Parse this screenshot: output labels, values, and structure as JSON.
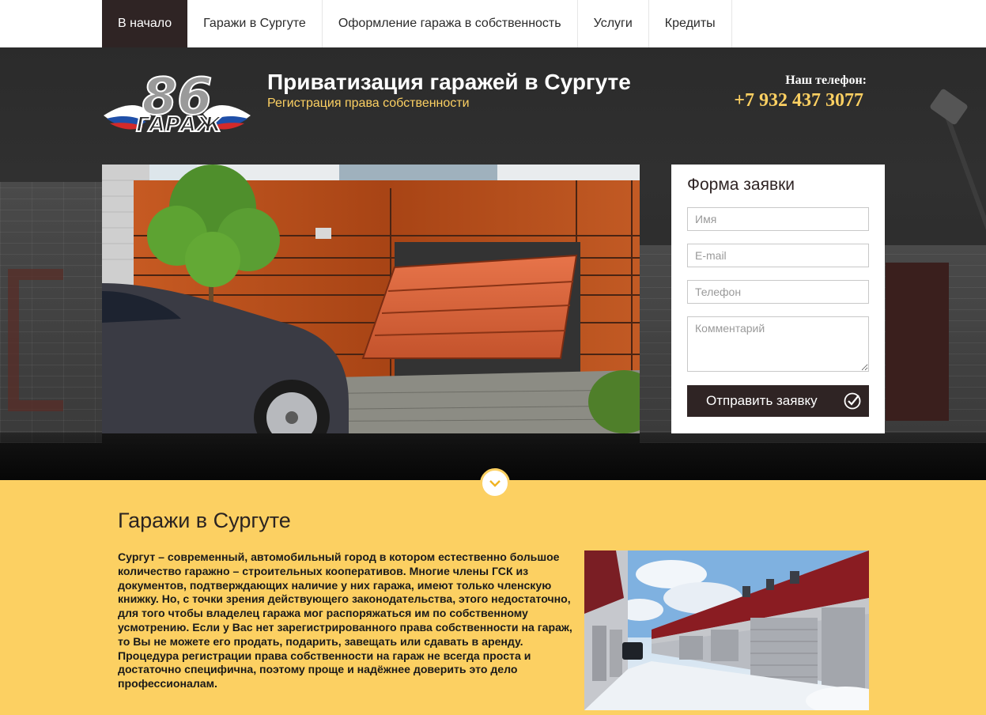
{
  "nav": {
    "items": [
      {
        "label": "В начало",
        "active": true
      },
      {
        "label": "Гаражи в Сургуте",
        "active": false
      },
      {
        "label": "Оформление гаража в собственность",
        "active": false
      },
      {
        "label": "Услуги",
        "active": false
      },
      {
        "label": "Кредиты",
        "active": false
      }
    ]
  },
  "header": {
    "logo_text": "86 ГАРАЖ",
    "title": "Приватизация гаражей в Сургуте",
    "subtitle": "Регистрация права собственности",
    "phone_label": "Наш телефон:",
    "phone": "+7 932 437 3077"
  },
  "form": {
    "title": "Форма заявки",
    "name_placeholder": "Имя",
    "email_placeholder": "E-mail",
    "phone_placeholder": "Телефон",
    "comment_placeholder": "Комментарий",
    "name_value": "",
    "email_value": "",
    "phone_value": "",
    "comment_value": "",
    "submit_label": "Отправить заявку"
  },
  "content": {
    "title": "Гаражи в Сургуте",
    "body": "Сургут – современный, автомобильный город в котором естественно большое количество гаражно – строительных кооперативов. Многие члены ГСК из документов, подтверждающих наличие у них гаража, имеют только членскую книжку. Но, с точки зрения действующего законодательства, этого недостаточно, для того  чтобы владелец гаража мог распоряжаться им по собственному усмотрению. Если у Вас нет зарегистрированного права собственности на гараж, то Вы не можете его продать, подарить, завещать или сдавать в аренду. Процедура регистрации права собственности на гараж не всегда проста и достаточно специфична, поэтому проще и надёжнее доверить это дело профессионалам."
  },
  "colors": {
    "accent": "#fcd062",
    "dark": "#2f2424",
    "white": "#ffffff"
  },
  "icons": {
    "submit": "check-circle-icon",
    "scroll": "chevron-down-icon"
  }
}
